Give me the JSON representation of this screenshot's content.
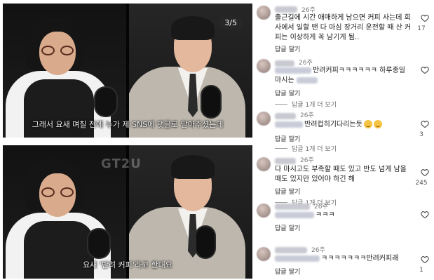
{
  "video": {
    "top_subtitle": "그래서 요새 며칠 전에 누가 제 SNS에 댓글로 달아주셨는데",
    "bottom_subtitle": "요새 '반려 커피'라고 한대요",
    "page_indicator": "3/5",
    "watermark": "GT2U"
  },
  "comments": [
    {
      "time": "26주",
      "text": "출근길에 시간 애매하게 남으면 커피 사는데 회사에서 일할 땐 다 마심 장거리 운전할 때 산 커피는 이상하게 꼭 남기게 됨..",
      "reply_label": "답글 달기",
      "likes": "17",
      "more_replies": ""
    },
    {
      "time": "26주",
      "text": "반려커피ㅋㅋㅋㅋㅋㅋ 하루종일",
      "text2": "마시는",
      "reply_label": "답글 달기",
      "likes": "",
      "more_replies": "답글 1개 더 보기"
    },
    {
      "time": "26주",
      "text": "반려컵히기다리는듯",
      "reply_label": "답글 달기",
      "likes": "3",
      "more_replies": "답글 1개 더 보기"
    },
    {
      "time": "26주",
      "text": "다 마시고도 부족할 때도 있고 반도 넘게 남을 때도 있지만 있어야 하긴 해",
      "reply_label": "답글 달기",
      "likes": "245",
      "more_replies": "답글 1개 더 보기"
    },
    {
      "time": "26주",
      "text": "ㅋㅋㅋ",
      "reply_label": "답글 달기",
      "likes": "",
      "more_replies": ""
    },
    {
      "time": "26주",
      "text": "ㅋㅋㅋㅋㅋㅋㅋ반려커피래",
      "reply_label": "답글 달기",
      "likes": "1",
      "more_replies": ""
    }
  ],
  "icons": {
    "heart": "heart-outline-icon",
    "emoji": "smiley-emoji-icon"
  },
  "colors": {
    "text": "#1a1a1a",
    "muted": "#7a7a7a",
    "background": "#ffffff"
  }
}
